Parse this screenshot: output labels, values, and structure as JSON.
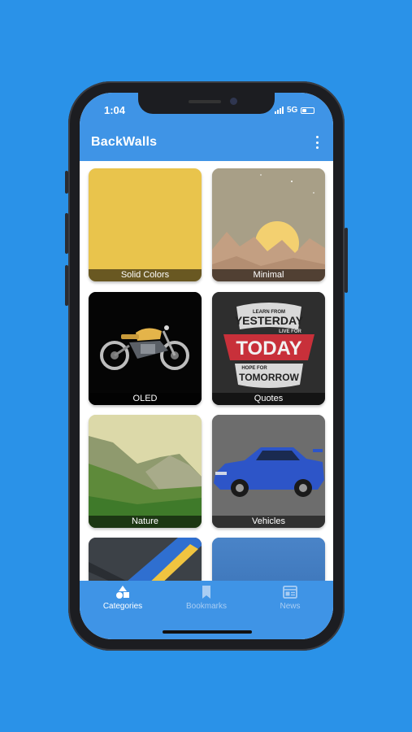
{
  "status_bar": {
    "time": "1:04",
    "network": "5G"
  },
  "app_bar": {
    "title": "BackWalls",
    "menu_icon": "more-vert-icon"
  },
  "categories": [
    {
      "label": "Solid Colors"
    },
    {
      "label": "Minimal"
    },
    {
      "label": "OLED"
    },
    {
      "label": "Quotes",
      "image_text": [
        "LEARN FROM",
        "YESTERDAY",
        "LIVE FOR",
        "TODAY",
        "HOPE FOR",
        "TOMORROW"
      ]
    },
    {
      "label": "Nature"
    },
    {
      "label": "Vehicles"
    }
  ],
  "bottom_nav": {
    "items": [
      {
        "label": "Categories",
        "icon": "shapes-icon",
        "active": true
      },
      {
        "label": "Bookmarks",
        "icon": "bookmark-icon",
        "active": false
      },
      {
        "label": "News",
        "icon": "newspaper-icon",
        "active": false
      }
    ]
  },
  "colors": {
    "background": "#2a92e8",
    "app_bar": "#3f94e6",
    "active_tab": "#ffffff",
    "inactive_tab": "#a9cdf3"
  }
}
